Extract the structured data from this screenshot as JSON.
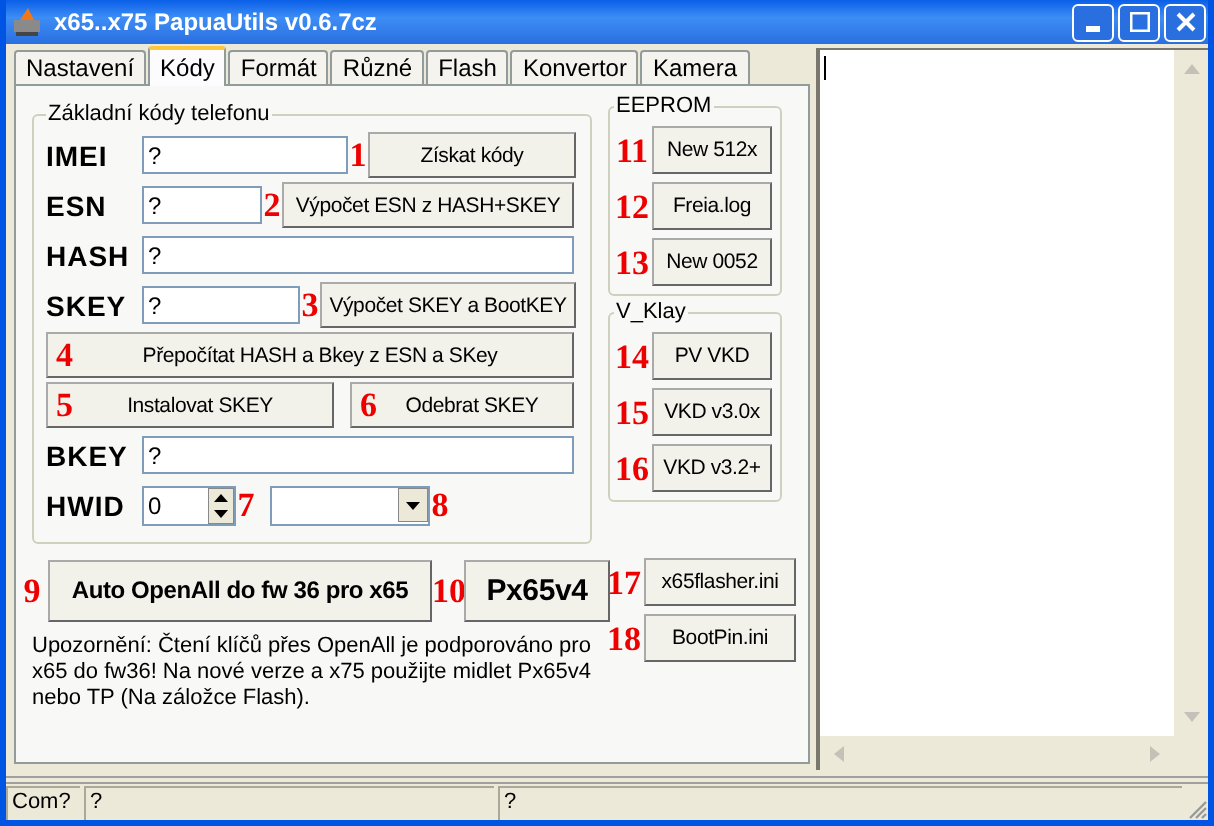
{
  "window": {
    "title": "x65..x75 PapuaUtils v0.6.7cz"
  },
  "tabs": [
    {
      "label": "Nastavení",
      "selected": false
    },
    {
      "label": "Kódy",
      "selected": true
    },
    {
      "label": "Formát",
      "selected": false
    },
    {
      "label": "Různé",
      "selected": false
    },
    {
      "label": "Flash",
      "selected": false
    },
    {
      "label": "Konvertor",
      "selected": false
    },
    {
      "label": "Kamera",
      "selected": false
    }
  ],
  "basic_codes": {
    "title": "Základní kódy telefonu",
    "imei": {
      "label": "IMEI",
      "value": "?",
      "marker": "1",
      "button": "Získat kódy"
    },
    "esn": {
      "label": "ESN",
      "value": "?",
      "marker": "2",
      "button": "Výpočet ESN z HASH+SKEY"
    },
    "hash": {
      "label": "HASH",
      "value": "?"
    },
    "skey": {
      "label": "SKEY",
      "value": "?",
      "marker": "3",
      "button": "Výpočet SKEY a BootKEY"
    },
    "recalc": {
      "marker": "4",
      "button": "Přepočítat HASH a Bkey z ESN a SKey"
    },
    "install": {
      "marker": "5",
      "button": "Instalovat SKEY"
    },
    "remove": {
      "marker": "6",
      "button": "Odebrat SKEY"
    },
    "bkey": {
      "label": "BKEY",
      "value": "?"
    },
    "hwid": {
      "label": "HWID",
      "value": "0",
      "spin_marker": "7",
      "combo_marker": "8"
    }
  },
  "eeprom": {
    "title": "EEPROM",
    "buttons": [
      {
        "marker": "11",
        "label": "New 512x"
      },
      {
        "marker": "12",
        "label": "Freia.log"
      },
      {
        "marker": "13",
        "label": "New 0052"
      }
    ]
  },
  "v_klay": {
    "title": "V_Klay",
    "buttons": [
      {
        "marker": "14",
        "label": "PV VKD"
      },
      {
        "marker": "15",
        "label": "VKD v3.0x"
      },
      {
        "marker": "16",
        "label": "VKD v3.2+"
      }
    ]
  },
  "auto_openall": {
    "marker": "9",
    "label": "Auto OpenAll do fw 36 pro x65"
  },
  "px65v4": {
    "marker": "10",
    "label": "Px65v4"
  },
  "ini_buttons": [
    {
      "marker": "17",
      "label": "x65flasher.ini"
    },
    {
      "marker": "18",
      "label": "BootPin.ini"
    }
  ],
  "note": "Upozornění: Čtení klíčů přes OpenAll je podporováno pro x65 do fw36! Na nové verze a x75 použijte midlet Px65v4 nebo TP (Na záložce Flash).",
  "status_bar": [
    "Com?",
    "?",
    "?"
  ]
}
